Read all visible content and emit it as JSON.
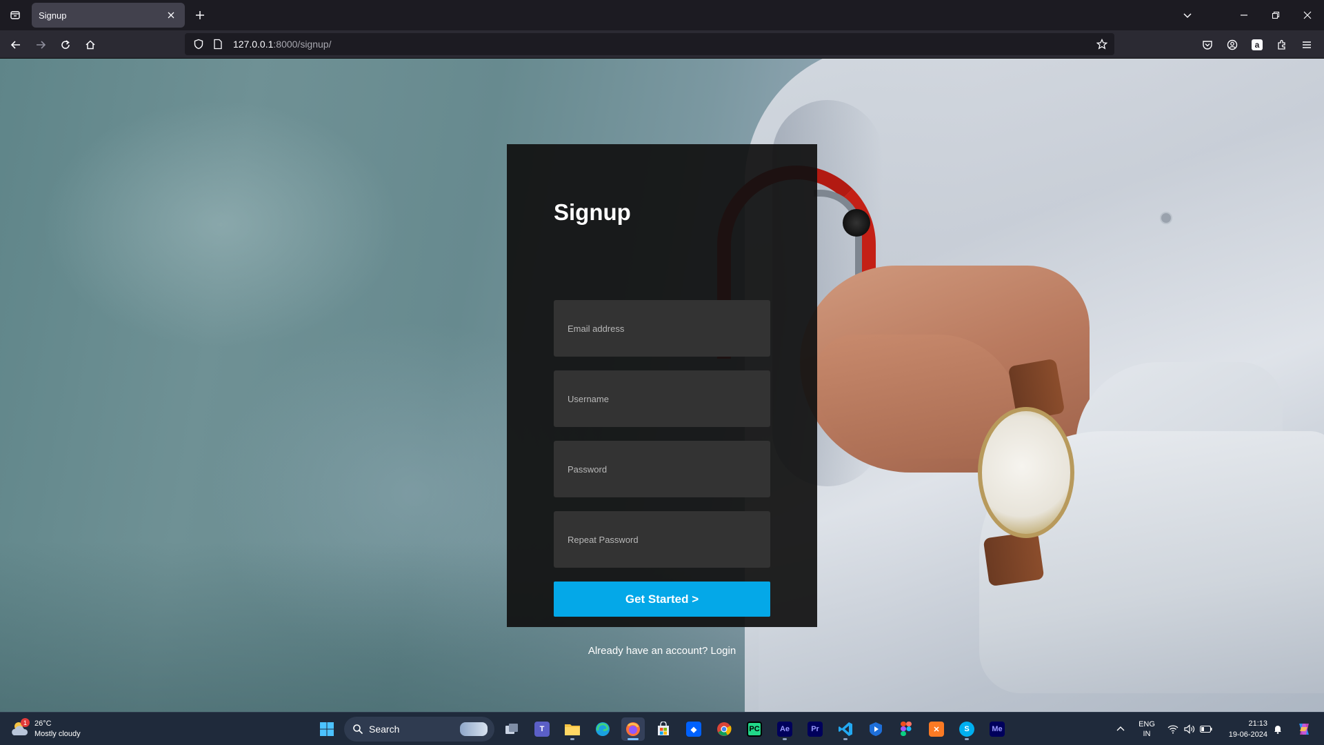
{
  "browser": {
    "tab_title": "Signup",
    "url_host": "127.0.0.1",
    "url_rest": ":8000/signup/"
  },
  "signup": {
    "heading": "Signup",
    "email_placeholder": "Email address",
    "username_placeholder": "Username",
    "password_placeholder": "Password",
    "repeat_password_placeholder": "Repeat Password",
    "submit_label": "Get Started >",
    "login_prompt": "Already have an account?",
    "login_link": "Login"
  },
  "taskbar": {
    "weather_temp": "26°C",
    "weather_desc": "Mostly cloudy",
    "weather_badge": "1",
    "search_label": "Search",
    "lang_line1": "ENG",
    "lang_line2": "IN",
    "time": "21:13",
    "date": "19-06-2024",
    "apps": [
      "windows-start",
      "search",
      "task-view",
      "teams",
      "file-explorer",
      "edge",
      "firefox",
      "microsoft-store",
      "dropbox",
      "chrome",
      "pycharm",
      "after-effects",
      "premiere-pro",
      "vscode",
      "media-player",
      "figma",
      "xampp",
      "skype",
      "media-encoder"
    ]
  },
  "colors": {
    "accent": "#04a8e8",
    "card_bg": "#111111",
    "field_bg": "#333333"
  }
}
